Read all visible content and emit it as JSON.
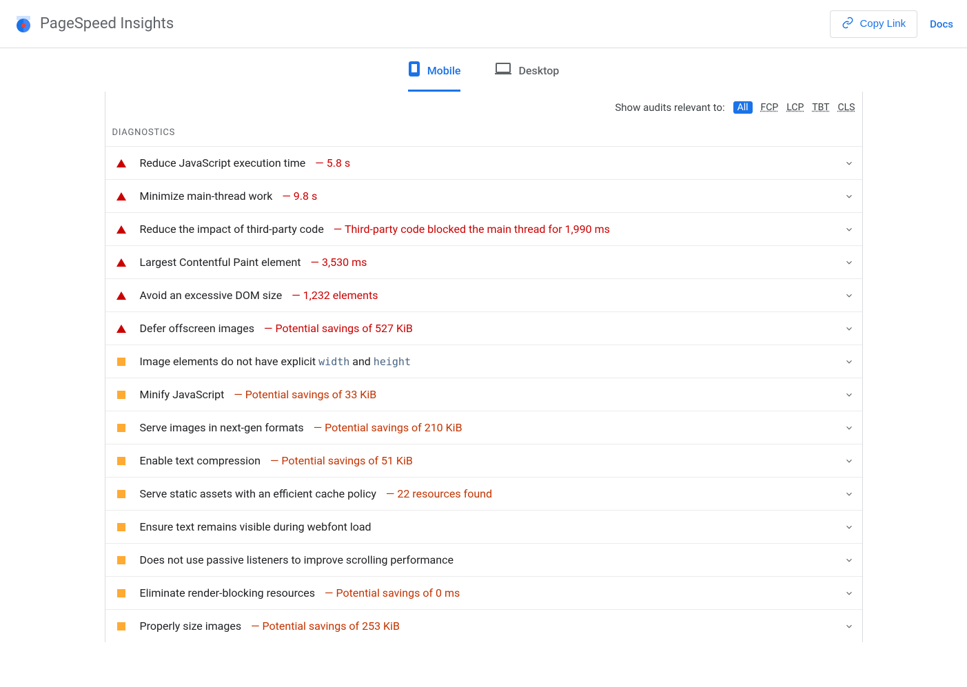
{
  "header": {
    "title": "PageSpeed Insights",
    "copy_link_label": "Copy Link",
    "docs_label": "Docs"
  },
  "tabs": {
    "mobile": "Mobile",
    "desktop": "Desktop"
  },
  "filters": {
    "label": "Show audits relevant to:",
    "all": "All",
    "fcp": "FCP",
    "lcp": "LCP",
    "tbt": "TBT",
    "cls": "CLS"
  },
  "section": {
    "diagnostics_label": "DIAGNOSTICS"
  },
  "audits": [
    {
      "severity": "fail",
      "title": "Reduce JavaScript execution time",
      "value": "— 5.8 s"
    },
    {
      "severity": "fail",
      "title": "Minimize main-thread work",
      "value": "— 9.8 s"
    },
    {
      "severity": "fail",
      "title": "Reduce the impact of third-party code",
      "value": "— Third-party code blocked the main thread for 1,990 ms"
    },
    {
      "severity": "fail",
      "title": "Largest Contentful Paint element",
      "value": "— 3,530 ms"
    },
    {
      "severity": "fail",
      "title": "Avoid an excessive DOM size",
      "value": "— 1,232 elements"
    },
    {
      "severity": "fail",
      "title": "Defer offscreen images",
      "value": "— Potential savings of 527 KiB"
    },
    {
      "severity": "warn",
      "title_pre": "Image elements do not have explicit ",
      "code1": "width",
      "mid": " and ",
      "code2": "height",
      "value": ""
    },
    {
      "severity": "warn",
      "title": "Minify JavaScript",
      "value": "— Potential savings of 33 KiB"
    },
    {
      "severity": "warn",
      "title": "Serve images in next-gen formats",
      "value": "— Potential savings of 210 KiB"
    },
    {
      "severity": "warn",
      "title": "Enable text compression",
      "value": "— Potential savings of 51 KiB"
    },
    {
      "severity": "warn",
      "title": "Serve static assets with an efficient cache policy",
      "value": "— 22 resources found"
    },
    {
      "severity": "warn",
      "title": "Ensure text remains visible during webfont load",
      "value": ""
    },
    {
      "severity": "warn",
      "title": "Does not use passive listeners to improve scrolling performance",
      "value": ""
    },
    {
      "severity": "warn",
      "title": "Eliminate render-blocking resources",
      "value": "— Potential savings of 0 ms"
    },
    {
      "severity": "warn",
      "title": "Properly size images",
      "value": "— Potential savings of 253 KiB"
    }
  ]
}
